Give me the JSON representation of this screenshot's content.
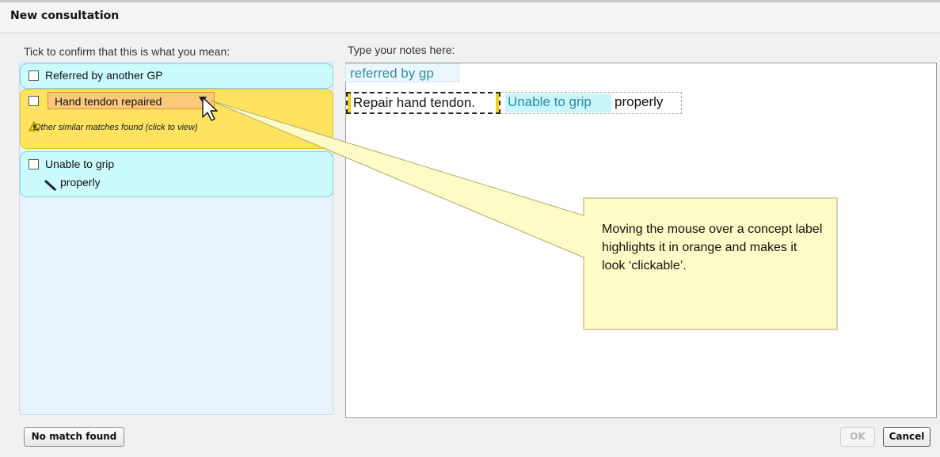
{
  "window": {
    "title": "New consultation"
  },
  "left": {
    "instruction": "Tick to confirm that this is what you mean:",
    "items": [
      {
        "label": "Referred by another GP"
      },
      {
        "label": "Hand tendon repaired",
        "warning": "Other similar matches found (click to view)"
      },
      {
        "label": "Unable to grip",
        "sub": "properly"
      }
    ]
  },
  "notes": {
    "instruction": "Type your notes here:",
    "line1": "referred by gp",
    "line2_part1": "Repair hand tendon.",
    "line2_part2": "Unable to grip",
    "line2_part3": "properly"
  },
  "callout": {
    "text": "Moving the mouse over a concept label highlights it in orange and makes it look ‘clickable’."
  },
  "buttons": {
    "no_match": "No match found",
    "ok": "OK",
    "cancel": "Cancel"
  },
  "colors": {
    "concept_cyan": "#ccfbfd",
    "highlight_orange": "#fcc97a",
    "selected_yellow": "#fde360",
    "callout_yellow": "#fefbc6"
  }
}
